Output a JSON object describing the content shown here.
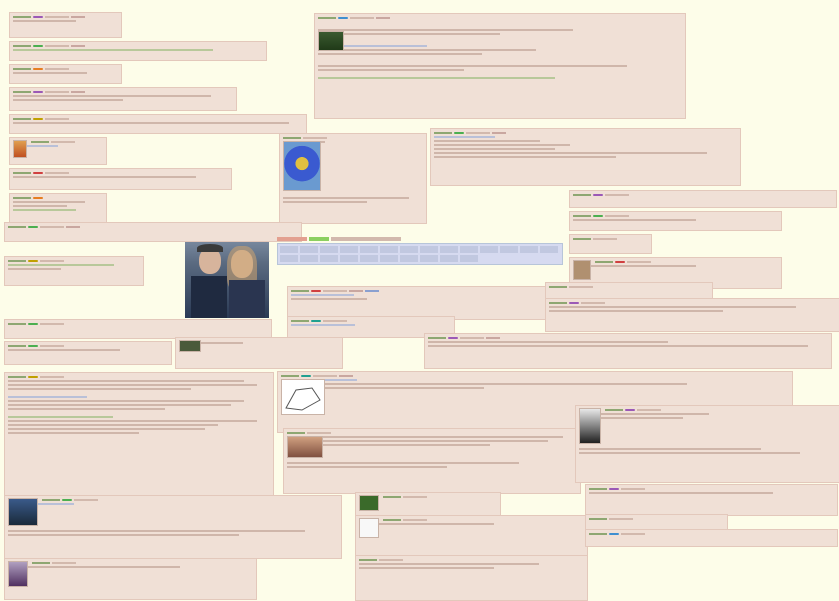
{
  "page": {
    "background": "#fdfde9",
    "post_background": "#f0e0d6",
    "post_border": "#e3c8bb"
  },
  "id_colors": [
    "#9b59b6",
    "#4caf50",
    "#e67e22",
    "#c0a000",
    "#3f8fd0",
    "#d04040",
    "#20a090"
  ],
  "icons": [
    "portrait-thumb-icon",
    "couple-photo-icon",
    "bird-thumb-icon",
    "sketch-thumb-icon",
    "figure-thumb-icon",
    "night-scene-thumb-icon"
  ]
}
